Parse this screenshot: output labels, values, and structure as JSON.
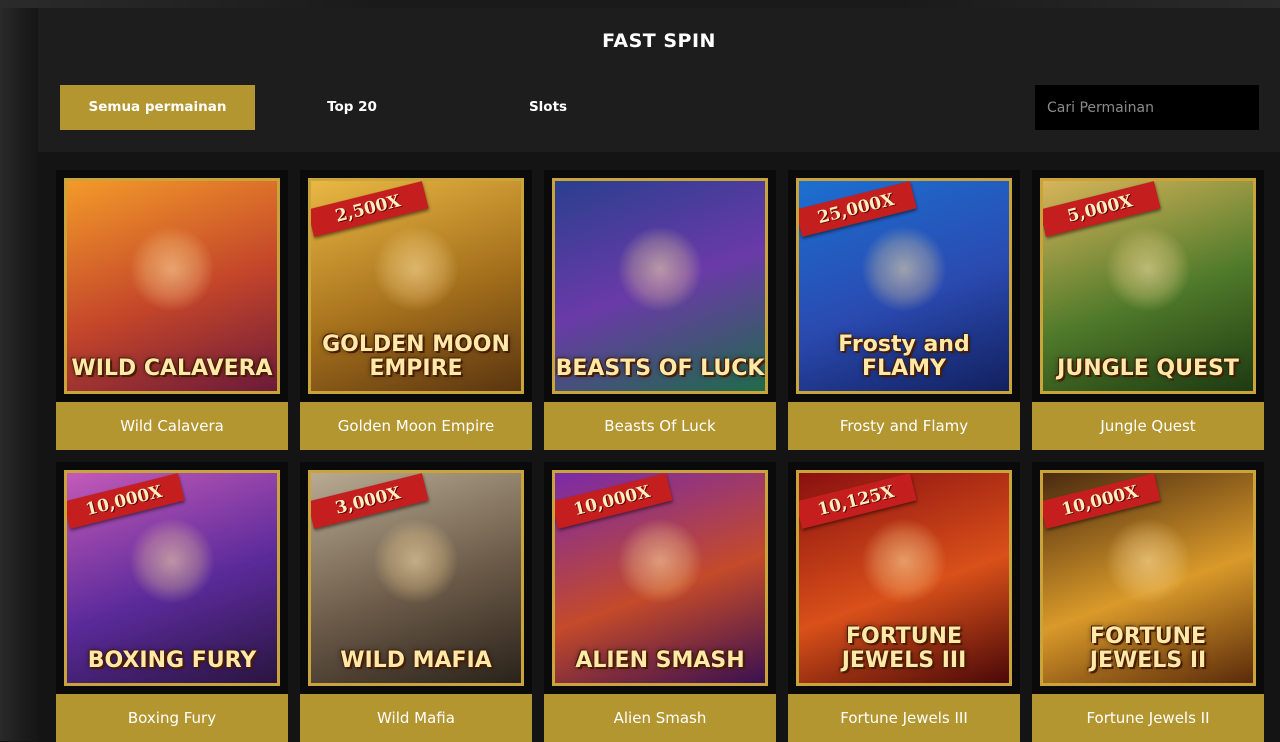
{
  "header": {
    "title": "FAST SPIN"
  },
  "tabs": [
    {
      "label": "Semua permainan",
      "active": true
    },
    {
      "label": "Top 20",
      "active": false
    },
    {
      "label": "Slots",
      "active": false
    }
  ],
  "search": {
    "placeholder": "Cari Permainan"
  },
  "colors": {
    "accent": "#b49631",
    "frame": "#c9a43a",
    "ribbon": "#c41e1e"
  },
  "games": [
    {
      "name": "Wild Calavera",
      "multiplier": "",
      "logo": "WILD CALAVERA",
      "art": "linear-gradient(160deg,#f39a2a,#c3452a 55%,#6b1a3a)"
    },
    {
      "name": "Golden Moon Empire",
      "multiplier": "2,500X",
      "logo": "GOLDEN MOON EMPIRE",
      "art": "linear-gradient(160deg,#e9b844,#a5701c 55%,#5a3510)"
    },
    {
      "name": "Beasts Of Luck",
      "multiplier": "",
      "logo": "BEASTS OF LUCK",
      "art": "linear-gradient(160deg,#2a3f8f,#6a3aa8 50%,#1f6b4a)"
    },
    {
      "name": "Frosty and Flamy",
      "multiplier": "25,000X",
      "logo": "Frosty and FLAMY",
      "art": "linear-gradient(160deg,#1c6fd1,#2a4ab0 55%,#12205e)"
    },
    {
      "name": "Jungle Quest",
      "multiplier": "5,000X",
      "logo": "JUNGLE QUEST",
      "art": "linear-gradient(160deg,#d8b45a,#4f7a2a 55%,#1e3a12)"
    },
    {
      "name": "Boxing Fury",
      "multiplier": "10,000X",
      "logo": "BOXING FURY",
      "art": "linear-gradient(160deg,#c45ab8,#5a2a9a 55%,#2a1540)"
    },
    {
      "name": "Wild Mafia",
      "multiplier": "3,000X",
      "logo": "WILD MAFIA",
      "art": "linear-gradient(160deg,#b8ab92,#6b5a48 55%,#2a221a)"
    },
    {
      "name": "Alien Smash",
      "multiplier": "10,000X",
      "logo": "ALIEN SMASH",
      "art": "linear-gradient(160deg,#7a2aa8,#c44a2a 55%,#3a1050)"
    },
    {
      "name": "Fortune Jewels III",
      "multiplier": "10,125X",
      "logo": "FORTUNE JEWELS III",
      "art": "linear-gradient(160deg,#8a1010,#d9501a 55%,#4a0808)"
    },
    {
      "name": "Fortune Jewels II",
      "multiplier": "10,000X",
      "logo": "FORTUNE JEWELS II",
      "art": "linear-gradient(160deg,#4a2a10,#d99a2a 55%,#5a2a0a)"
    }
  ]
}
